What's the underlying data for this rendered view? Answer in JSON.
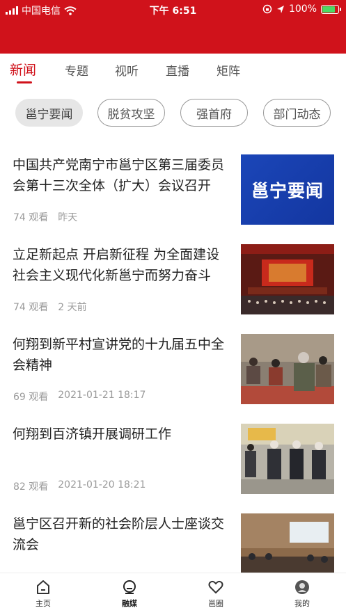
{
  "status_bar": {
    "carrier": "中国电信",
    "time": "下午 6:51",
    "battery_percent": "100%",
    "battery_level": 1.0,
    "signal_icon": "signal-icon",
    "wifi_icon": "wifi-icon"
  },
  "theme": {
    "accent": "#d0121b",
    "chip_active_bg": "#e6e6e6"
  },
  "tabs": [
    {
      "label": "新闻",
      "active": true
    },
    {
      "label": "专题",
      "active": false
    },
    {
      "label": "视听",
      "active": false
    },
    {
      "label": "直播",
      "active": false
    },
    {
      "label": "矩阵",
      "active": false
    }
  ],
  "chips": [
    {
      "label": "邕宁要闻",
      "active": true
    },
    {
      "label": "脱贫攻坚",
      "active": false
    },
    {
      "label": "强首府",
      "active": false
    },
    {
      "label": "部门动态",
      "active": false
    }
  ],
  "news": [
    {
      "title": "中国共产党南宁市邕宁区第三届委员会第十三次全体（扩大）会议召开",
      "views": "74 观看",
      "time": "昨天",
      "thumb_text": "邕宁要闻"
    },
    {
      "title": "立足新起点 开启新征程 为全面建设社会主义现代化新邕宁而努力奋斗",
      "views": "74 观看",
      "time": "2 天前",
      "thumb_text": ""
    },
    {
      "title": "何翔到新平村宣讲党的十九届五中全会精神",
      "views": "69 观看",
      "time": "2021-01-21 18:17",
      "thumb_text": ""
    },
    {
      "title": "何翔到百济镇开展调研工作",
      "views": "82 观看",
      "time": "2021-01-20 18:21",
      "thumb_text": ""
    },
    {
      "title": "邕宁区召开新的社会阶层人士座谈交流会",
      "views": "",
      "time": "",
      "thumb_text": ""
    }
  ],
  "tabbar": [
    {
      "label": "主页",
      "icon": "home-icon",
      "active": false
    },
    {
      "label": "融媒",
      "icon": "media-icon",
      "active": true
    },
    {
      "label": "邕圈",
      "icon": "heart-icon",
      "active": false
    },
    {
      "label": "我的",
      "icon": "profile-icon",
      "active": false
    }
  ]
}
